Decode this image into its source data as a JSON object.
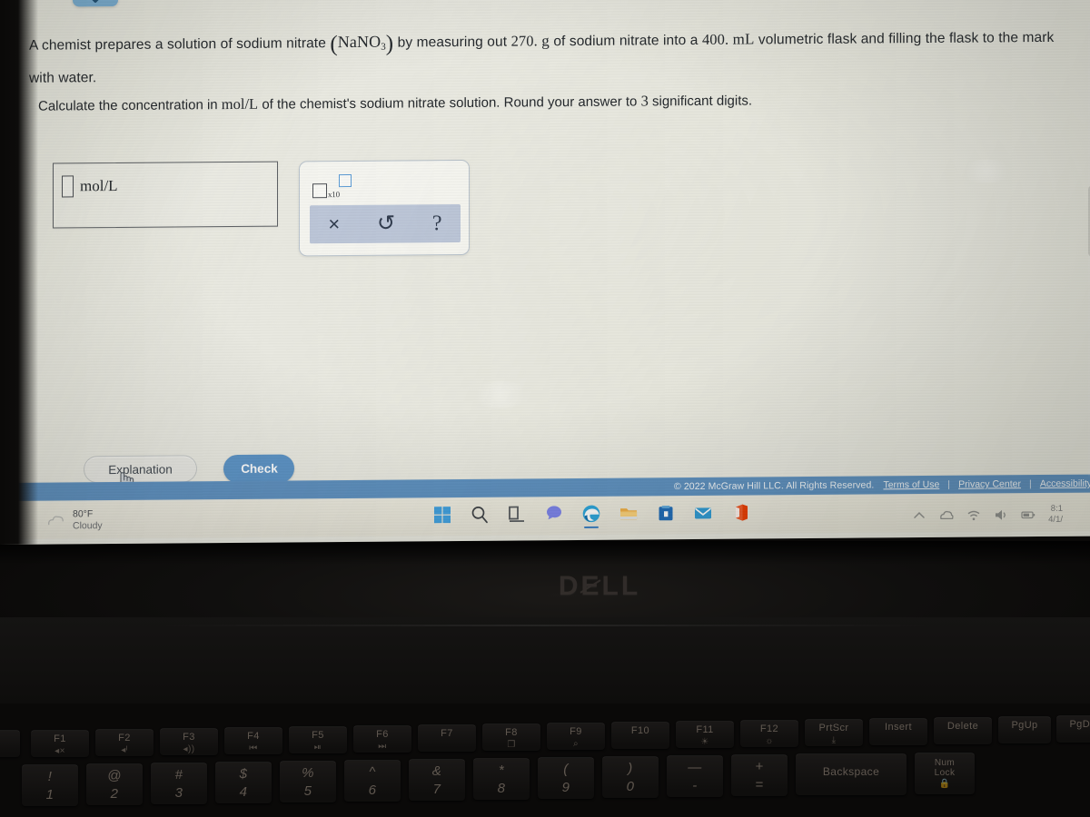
{
  "problem": {
    "text_part1": "A chemist prepares a solution of sodium nitrate",
    "formula": "NaNO",
    "formula_sub": "3",
    "text_part2": "by measuring out",
    "mass_value": "270.",
    "mass_unit": "g",
    "text_part3": "of sodium nitrate into a",
    "volume_value": "400.",
    "volume_unit": "mL",
    "text_part4": "volumetric flask and filling the flask to the mark with water.",
    "question": "Calculate the concentration in",
    "question_unit": "mol/L",
    "question_part2": "of the chemist's sodium nitrate solution. Round your answer to",
    "sig_digits": "3",
    "question_part3": "significant digits."
  },
  "answer": {
    "input_value": "",
    "unit_label": "mol/L"
  },
  "tool_panel": {
    "sci_notation_label": "x10",
    "clear_label": "×",
    "undo_label": "↺",
    "help_label": "?",
    "clear_name": "clear",
    "undo_name": "undo",
    "help_name": "help"
  },
  "buttons": {
    "explanation": "Explanation",
    "check": "Check"
  },
  "footer": {
    "copyright": "© 2022 McGraw Hill LLC. All Rights Reserved.",
    "link_terms": "Terms of Use",
    "link_privacy": "Privacy Center",
    "link_accessibility": "Accessibility",
    "separator": "|",
    "bar_color": "#5d90c0"
  },
  "taskbar": {
    "weather": {
      "temperature": "80°F",
      "condition": "Cloudy"
    },
    "icons": [
      {
        "name": "start-icon",
        "label": "Start"
      },
      {
        "name": "search-icon",
        "label": "Search"
      },
      {
        "name": "task-view-icon",
        "label": "Task View"
      },
      {
        "name": "chat-icon",
        "label": "Chat"
      },
      {
        "name": "edge-browser-icon",
        "label": "Microsoft Edge"
      },
      {
        "name": "file-explorer-icon",
        "label": "File Explorer"
      },
      {
        "name": "microsoft-store-icon",
        "label": "Microsoft Store"
      },
      {
        "name": "mail-icon",
        "label": "Mail"
      },
      {
        "name": "office-icon",
        "label": "Office"
      }
    ],
    "tray": [
      {
        "name": "show-hidden-icons-icon"
      },
      {
        "name": "onedrive-icon"
      },
      {
        "name": "wifi-icon"
      },
      {
        "name": "volume-icon"
      },
      {
        "name": "battery-icon"
      }
    ],
    "clock": {
      "time": "8:1",
      "date": "4/1/"
    }
  },
  "laptop": {
    "brand": "DØLL",
    "brand_pre": "D",
    "brand_o": "E",
    "brand_post": "LL",
    "function_keys": [
      {
        "label": "F1",
        "icon": "◂×"
      },
      {
        "label": "F2",
        "icon": "◂ᴵ"
      },
      {
        "label": "F3",
        "icon": "◂))"
      },
      {
        "label": "F4",
        "icon": "⏮"
      },
      {
        "label": "F5",
        "icon": "⏯"
      },
      {
        "label": "F6",
        "icon": "⏭"
      },
      {
        "label": "F7",
        "icon": ""
      },
      {
        "label": "F8",
        "icon": "❐"
      },
      {
        "label": "F9",
        "icon": "⌕"
      },
      {
        "label": "F10",
        "icon": ""
      },
      {
        "label": "F11",
        "icon": "☀"
      },
      {
        "label": "F12",
        "icon": "☼"
      }
    ],
    "nav_keys": [
      {
        "label": "PrtScr",
        "icon": "⤓"
      },
      {
        "label": "Insert",
        "icon": ""
      },
      {
        "label": "Delete",
        "icon": ""
      },
      {
        "label": "PgUp",
        "icon": ""
      },
      {
        "label": "PgDn",
        "icon": ""
      }
    ],
    "number_row": [
      {
        "sym": "!",
        "num": "1"
      },
      {
        "sym": "@",
        "num": "2"
      },
      {
        "sym": "#",
        "num": "3"
      },
      {
        "sym": "$",
        "num": "4"
      },
      {
        "sym": "%",
        "num": "5"
      },
      {
        "sym": "^",
        "num": "6"
      },
      {
        "sym": "&",
        "num": "7"
      },
      {
        "sym": "*",
        "num": "8"
      },
      {
        "sym": "(",
        "num": "9"
      },
      {
        "sym": ")",
        "num": "0"
      },
      {
        "sym": "—",
        "num": "-"
      },
      {
        "sym": "+",
        "num": "="
      }
    ],
    "backspace_label": "Backspace",
    "numlock_label_1": "Num",
    "numlock_label_2": "Lock"
  }
}
